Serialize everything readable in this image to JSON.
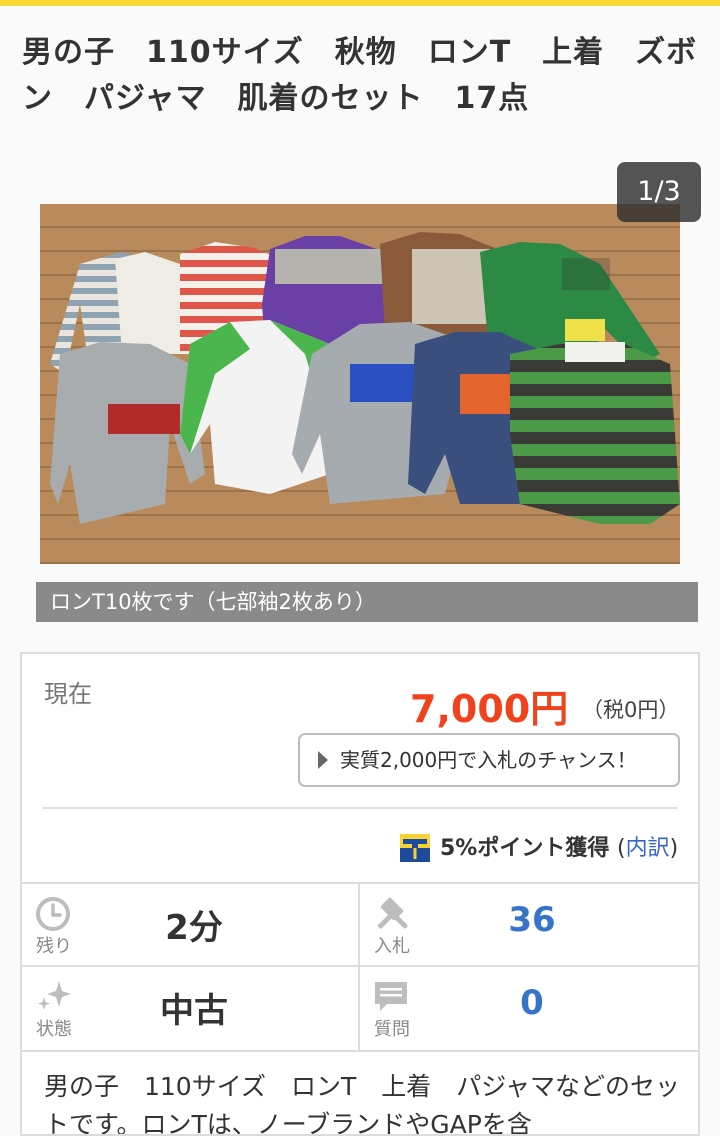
{
  "title": "男の子　110サイズ　秋物　ロンT　上着　ズボン　パジャマ　肌着のセット　17点",
  "gallery": {
    "counter": "1/3",
    "caption": "ロンT10枚です（七部袖2枚あり）"
  },
  "price_panel": {
    "current_label": "現在",
    "price": "7,000円",
    "tax": "（税0円）",
    "chance_button": "実質2,000円で入札のチャンス！",
    "points_text": "5%ポイント獲得",
    "points_paren_open": "(",
    "points_link": "内訳",
    "points_paren_close": ")"
  },
  "stats": {
    "time_left": {
      "label": "残り",
      "value": "2分",
      "icon": "clock-icon"
    },
    "bids": {
      "label": "入札",
      "value": "36",
      "icon": "gavel-icon"
    },
    "condition": {
      "label": "状態",
      "value": "中古",
      "icon": "sparkle-icon"
    },
    "questions": {
      "label": "質問",
      "value": "0",
      "icon": "speech-bubble-icon"
    }
  },
  "description": "男の子　110サイズ　ロンT　上着　パジャマなどのセットです。ロンTは、ノーブランドやGAPを含",
  "colors": {
    "accent_yellow": "#fbd836",
    "price_red": "#f0421c",
    "link_blue": "#3366cc",
    "value_blue": "#3574c9"
  }
}
